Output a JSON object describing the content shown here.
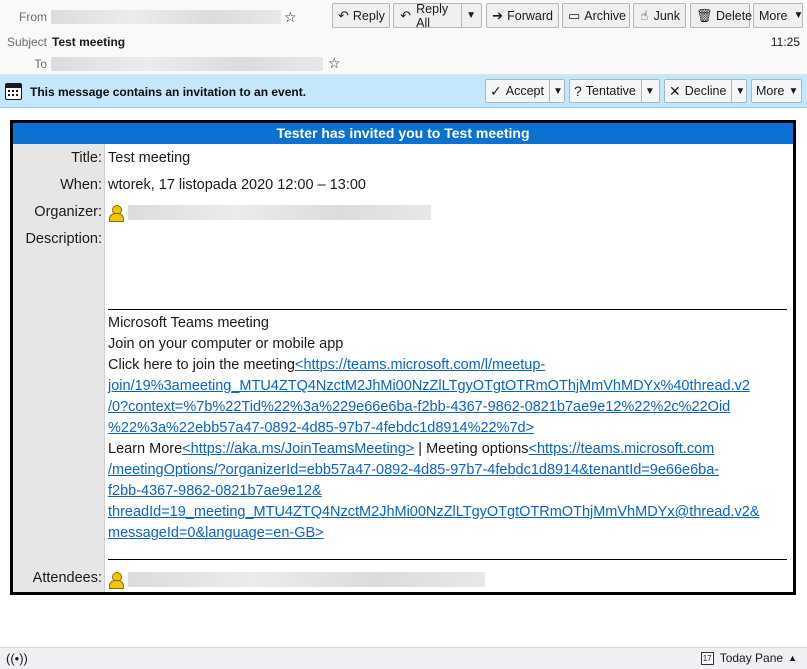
{
  "header": {
    "from_label": "From",
    "subject_label": "Subject",
    "subject": "Test meeting",
    "to_label": "To",
    "time": "11:25",
    "buttons": {
      "reply": "Reply",
      "reply_all": "Reply All",
      "forward": "Forward",
      "archive": "Archive",
      "junk": "Junk",
      "delete": "Delete",
      "more": "More"
    }
  },
  "invitation": {
    "notice": "This message contains an invitation to an event.",
    "accept": "Accept",
    "tentative": "Tentative",
    "decline": "Decline",
    "more": "More"
  },
  "event": {
    "banner": "Tester has invited you to Test meeting",
    "title_label": "Title:",
    "title": "Test meeting",
    "when_label": "When:",
    "when": "wtorek, 17 listopada 2020 12:00 – 13:00",
    "organizer_label": "Organizer:",
    "description_label": "Description:",
    "attendees_label": "Attendees:",
    "description": {
      "line1": "Microsoft Teams meeting",
      "line2": "Join on your computer or mobile app",
      "join_prefix": "Click here to join the meeting",
      "join_link_1": "<https://teams.microsoft.com/l/meetup-",
      "join_link_2": "join/19%3ameeting_MTU4ZTQ4NzctM2JhMi00NzZlLTgyOTgtOTRmOThjMmVhMDYx%40thread.v2",
      "join_link_3": "/0?context=%7b%22Tid%22%3a%229e66e6ba-f2bb-4367-9862-0821b7ae9e12%22%2c%22Oid",
      "join_link_4": "%22%3a%22ebb57a47-0892-4d85-97b7-4febdc1d8914%22%7d>",
      "learn_prefix": "Learn More",
      "learn_link": "<https://aka.ms/JoinTeamsMeeting>",
      "separator": " | Meeting options",
      "options_link_1": "<https://teams.microsoft.com",
      "options_link_2": "/meetingOptions/?organizerId=ebb57a47-0892-4d85-97b7-4febdc1d8914&tenantId=9e66e6ba-",
      "options_link_3": "f2bb-4367-9862-0821b7ae9e12&",
      "options_link_4": "threadId=19_meeting_MTU4ZTQ4NzctM2JhMi00NzZlLTgyOTgtOTRmOThjMmVhMDYx@thread.v2&",
      "options_link_5": "messageId=0&language=en-GB>"
    }
  },
  "statusbar": {
    "today_pane": "Today Pane",
    "cal_day": "17"
  }
}
